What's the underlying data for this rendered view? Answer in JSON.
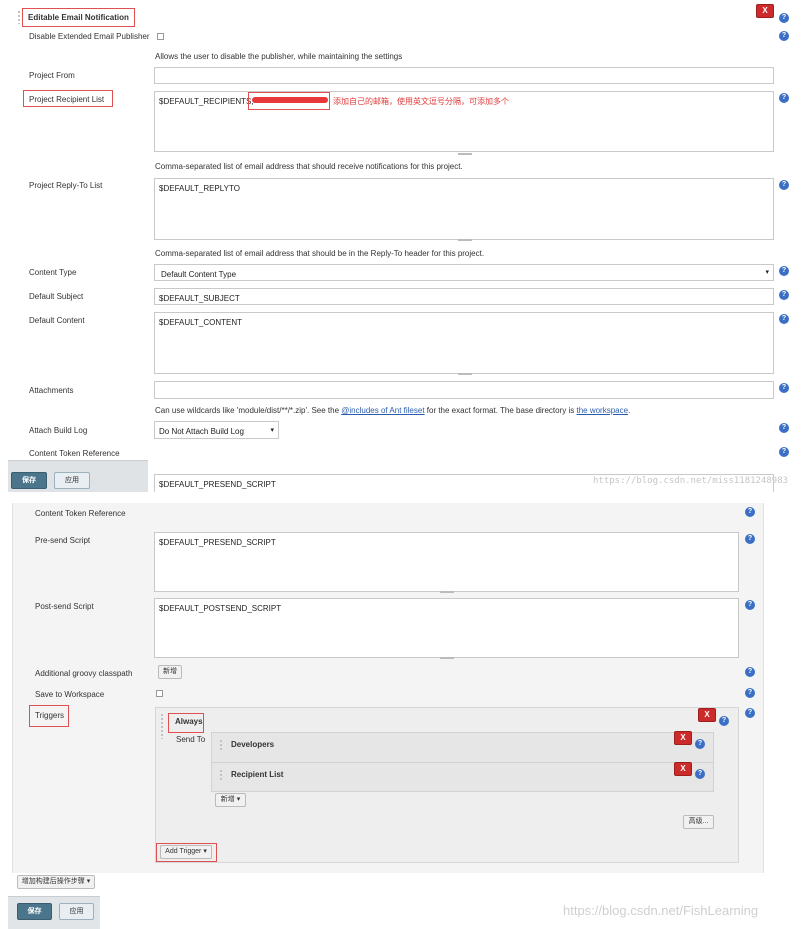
{
  "upper": {
    "section_title": "Editable Email Notification",
    "disable_publisher_label": "Disable Extended Email Publisher",
    "disable_publisher_help": "Allows the user to disable the publisher, while maintaining the settings",
    "project_from_label": "Project From",
    "project_from_value": "",
    "recipient_label": "Project Recipient List",
    "recipient_value": "$DEFAULT_RECIPIENTS,",
    "recipient_annotation": "添加自己的邮箱，使用英文逗号分隔，可添加多个",
    "recipient_help": "Comma-separated list of email address that should receive notifications for this project.",
    "replyto_label": "Project Reply-To List",
    "replyto_value": "$DEFAULT_REPLYTO",
    "replyto_help": "Comma-separated list of email address that should be in the Reply-To header for this project.",
    "content_type_label": "Content Type",
    "content_type_value": "Default Content Type",
    "subject_label": "Default Subject",
    "subject_value": "$DEFAULT_SUBJECT",
    "content_label": "Default Content",
    "content_value": "$DEFAULT_CONTENT",
    "attachments_label": "Attachments",
    "attachments_value": "",
    "attachments_help_pre": "Can use wildcards like 'module/dist/**/*.zip'. See the ",
    "attachments_help_link1": "@includes of Ant fileset",
    "attachments_help_mid": " for the exact format. The base directory is ",
    "attachments_help_link2": "the workspace",
    "attachments_help_end": ".",
    "attach_log_label": "Attach Build Log",
    "attach_log_value": "Do Not Attach Build Log",
    "token_ref_label": "Content Token Reference",
    "presend_partial_value": "$DEFAULT_PRESEND_SCRIPT",
    "save_button": "保存",
    "apply_button": "应用",
    "watermark": "https://blog.csdn.net/miss1181248983"
  },
  "lower": {
    "token_ref_label": "Content Token Reference",
    "presend_label": "Pre-send Script",
    "presend_value": "$DEFAULT_PRESEND_SCRIPT",
    "postsend_label": "Post-send Script",
    "postsend_value": "$DEFAULT_POSTSEND_SCRIPT",
    "classpath_label": "Additional groovy classpath",
    "classpath_add_button": "新增",
    "save_workspace_label": "Save to Workspace",
    "triggers_label": "Triggers",
    "trigger_name": "Always",
    "send_to_label": "Send To",
    "recipient_types": [
      "Developers",
      "Recipient List"
    ],
    "add_recipient_button": "新增",
    "advanced_button": "高级...",
    "add_trigger_button": "Add Trigger",
    "add_post_build_button": "增加构建后操作步骤",
    "save_button": "保存",
    "apply_button": "应用",
    "watermark": "https://blog.csdn.net/FishLearning"
  },
  "glyphs": {
    "help": "?",
    "close": "X",
    "dropdown": "▾"
  },
  "colors": {
    "accent_blue": "#3b6fc5",
    "delete_red": "#cc2b2b",
    "annotation_red": "#e05050"
  }
}
